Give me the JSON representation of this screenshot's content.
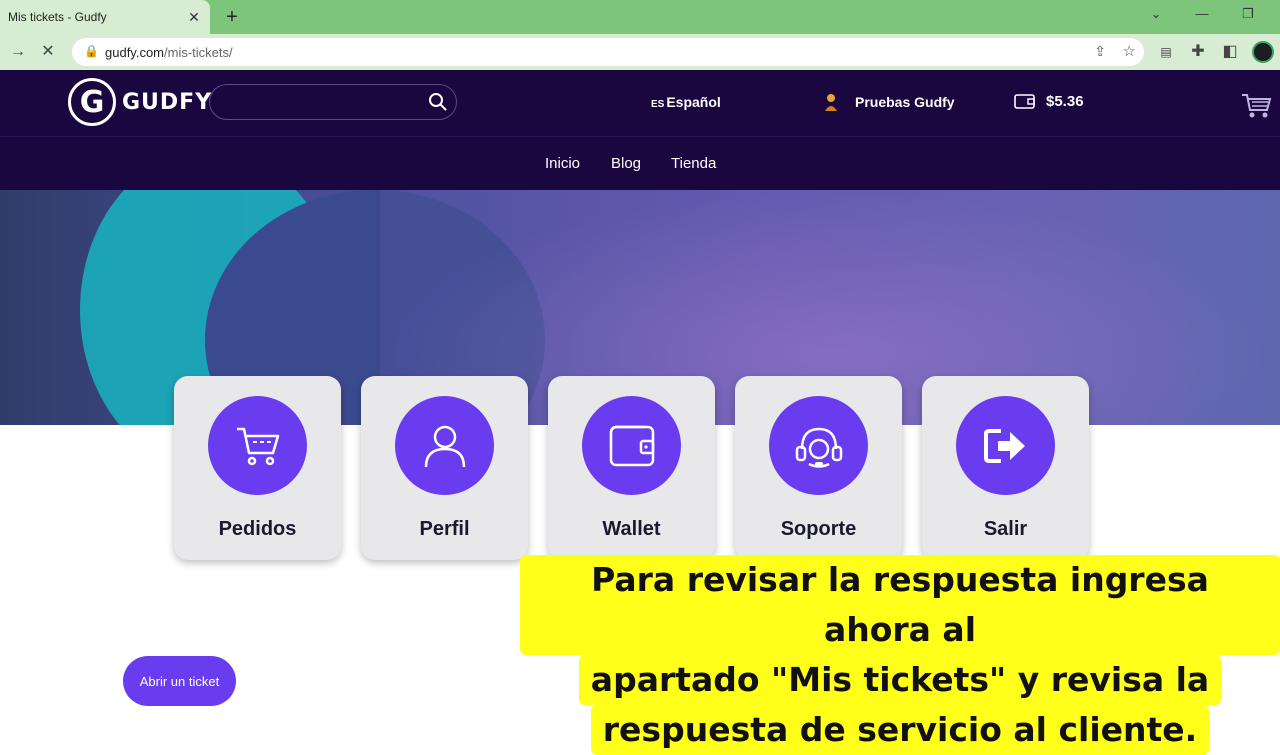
{
  "browser": {
    "tab_title": "Mis tickets - Gudfy",
    "url_host": "gudfy.com",
    "url_path": "/mis-tickets/"
  },
  "header": {
    "logo_text": "GUDFY",
    "search_placeholder": "",
    "language": "Español",
    "language_flag": "ES",
    "user_name": "Pruebas Gudfy",
    "wallet_balance": "$5.36"
  },
  "nav": {
    "items": [
      "Inicio",
      "Blog",
      "Tienda"
    ]
  },
  "cards": [
    {
      "label": "Pedidos",
      "icon": "cart-icon"
    },
    {
      "label": "Perfil",
      "icon": "user-icon"
    },
    {
      "label": "Wallet",
      "icon": "wallet-icon"
    },
    {
      "label": "Soporte",
      "icon": "headset-icon"
    },
    {
      "label": "Salir",
      "icon": "logout-icon"
    }
  ],
  "ticket_button": "Abrir un ticket",
  "caption": {
    "line1": "Para revisar la respuesta ingresa ahora al",
    "line2": "apartado \"Mis tickets\" y revisa la",
    "line3": "respuesta de servicio al cliente."
  },
  "colors": {
    "header_bg": "#1b073f",
    "accent": "#6a3cf0",
    "browser_green": "#7cc57a",
    "caption_bg": "#ffff1a"
  }
}
